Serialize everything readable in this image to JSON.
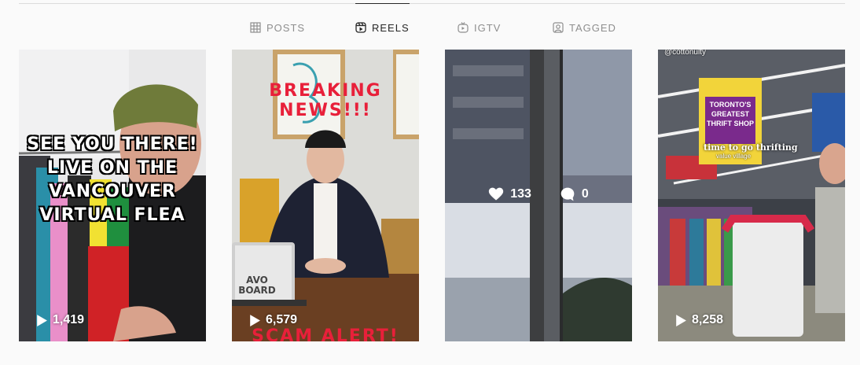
{
  "tabs": [
    {
      "label": "POSTS",
      "icon": "grid-icon",
      "active": false
    },
    {
      "label": "REELS",
      "icon": "reels-icon",
      "active": true
    },
    {
      "label": "IGTV",
      "icon": "igtv-icon",
      "active": false
    },
    {
      "label": "TAGGED",
      "icon": "tagged-icon",
      "active": false
    }
  ],
  "reels": [
    {
      "caption_lines": [
        "SEE YOU THERE!",
        "LIVE ON THE",
        "VANCOUVER",
        "VIRTUAL FLEA"
      ],
      "views": "1,419"
    },
    {
      "headline": "BREAKING NEWS!!!",
      "bottom_text": "SCAM ALERT!",
      "laptop_sticker": "AVO BOARD",
      "views": "6,579"
    },
    {
      "likes": "133",
      "comments": "0"
    },
    {
      "username": "@cottonulty",
      "sign_lines": [
        "TORONTO'S",
        "GREATEST",
        "THRIFT SHOP"
      ],
      "caption": "time to go thrifting",
      "store": "value village",
      "views": "8,258"
    }
  ],
  "colors": {
    "breaking_red": "#e8203a",
    "active_tab": "#262626",
    "inactive_tab": "#8e8e8e",
    "sign_purple": "#7a2a8c",
    "sign_yellow": "#f2d43a"
  }
}
